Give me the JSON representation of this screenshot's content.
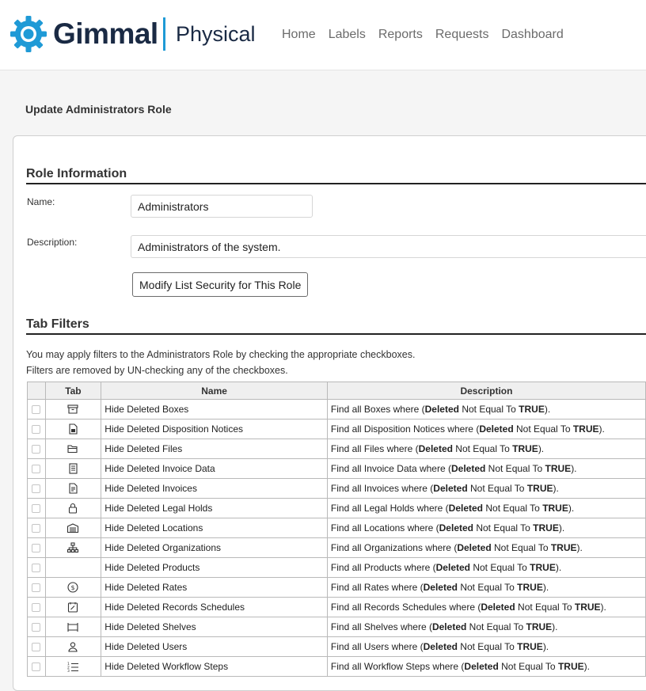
{
  "app": {
    "brand": "Gimmal",
    "product": "Physical",
    "brand_color": "#1f9ad6",
    "nav": [
      "Home",
      "Labels",
      "Reports",
      "Requests",
      "Dashboard"
    ]
  },
  "page_title": "Update Administrators Role",
  "role_info": {
    "heading": "Role Information",
    "name_label": "Name:",
    "name_value": "Administrators",
    "description_label": "Description:",
    "description_value": "Administrators of the system.",
    "modify_button": "Modify List Security for This Role"
  },
  "tab_filters": {
    "heading": "Tab Filters",
    "help_line1": "You may apply filters to the Administrators Role by checking the appropriate checkboxes.",
    "help_line2": "Filters are removed by UN-checking any of the checkboxes.",
    "columns": [
      "",
      "Tab",
      "Name",
      "Description"
    ],
    "rows": [
      {
        "checked": false,
        "icon": "box-icon",
        "name": "Hide Deleted Boxes",
        "desc_prefix": "Find all Boxes where (",
        "field": "Deleted",
        "op": " Not Equal To ",
        "value": "TRUE",
        "desc_suffix": ")."
      },
      {
        "checked": false,
        "icon": "document-icon",
        "name": "Hide Deleted Disposition Notices",
        "desc_prefix": "Find all Disposition Notices where (",
        "field": "Deleted",
        "op": " Not Equal To ",
        "value": "TRUE",
        "desc_suffix": ")."
      },
      {
        "checked": false,
        "icon": "folder-icon",
        "name": "Hide Deleted Files",
        "desc_prefix": "Find all Files where (",
        "field": "Deleted",
        "op": " Not Equal To ",
        "value": "TRUE",
        "desc_suffix": ")."
      },
      {
        "checked": false,
        "icon": "invoice-data-icon",
        "name": "Hide Deleted Invoice Data",
        "desc_prefix": "Find all Invoice Data where (",
        "field": "Deleted",
        "op": " Not Equal To ",
        "value": "TRUE",
        "desc_suffix": ")."
      },
      {
        "checked": false,
        "icon": "invoice-icon",
        "name": "Hide Deleted Invoices",
        "desc_prefix": "Find all Invoices where (",
        "field": "Deleted",
        "op": " Not Equal To ",
        "value": "TRUE",
        "desc_suffix": ")."
      },
      {
        "checked": false,
        "icon": "lock-icon",
        "name": "Hide Deleted Legal Holds",
        "desc_prefix": "Find all Legal Holds where (",
        "field": "Deleted",
        "op": " Not Equal To ",
        "value": "TRUE",
        "desc_suffix": ")."
      },
      {
        "checked": false,
        "icon": "warehouse-icon",
        "name": "Hide Deleted Locations",
        "desc_prefix": "Find all Locations where (",
        "field": "Deleted",
        "op": " Not Equal To ",
        "value": "TRUE",
        "desc_suffix": ")."
      },
      {
        "checked": false,
        "icon": "org-chart-icon",
        "name": "Hide Deleted Organizations",
        "desc_prefix": "Find all Organizations where (",
        "field": "Deleted",
        "op": " Not Equal To ",
        "value": "TRUE",
        "desc_suffix": ")."
      },
      {
        "checked": false,
        "icon": "",
        "name": "Hide Deleted Products",
        "desc_prefix": "Find all Products where (",
        "field": "Deleted",
        "op": " Not Equal To ",
        "value": "TRUE",
        "desc_suffix": ")."
      },
      {
        "checked": false,
        "icon": "dollar-circle-icon",
        "name": "Hide Deleted Rates",
        "desc_prefix": "Find all Rates where (",
        "field": "Deleted",
        "op": " Not Equal To ",
        "value": "TRUE",
        "desc_suffix": ")."
      },
      {
        "checked": false,
        "icon": "schedule-icon",
        "name": "Hide Deleted Records Schedules",
        "desc_prefix": "Find all Records Schedules where (",
        "field": "Deleted",
        "op": " Not Equal To ",
        "value": "TRUE",
        "desc_suffix": ")."
      },
      {
        "checked": false,
        "icon": "shelf-icon",
        "name": "Hide Deleted Shelves",
        "desc_prefix": "Find all Shelves where (",
        "field": "Deleted",
        "op": " Not Equal To ",
        "value": "TRUE",
        "desc_suffix": ")."
      },
      {
        "checked": false,
        "icon": "user-icon",
        "name": "Hide Deleted Users",
        "desc_prefix": "Find all Users where (",
        "field": "Deleted",
        "op": " Not Equal To ",
        "value": "TRUE",
        "desc_suffix": ")."
      },
      {
        "checked": false,
        "icon": "list-steps-icon",
        "name": "Hide Deleted Workflow Steps",
        "desc_prefix": "Find all Workflow Steps where (",
        "field": "Deleted",
        "op": " Not Equal To ",
        "value": "TRUE",
        "desc_suffix": ")."
      }
    ]
  }
}
